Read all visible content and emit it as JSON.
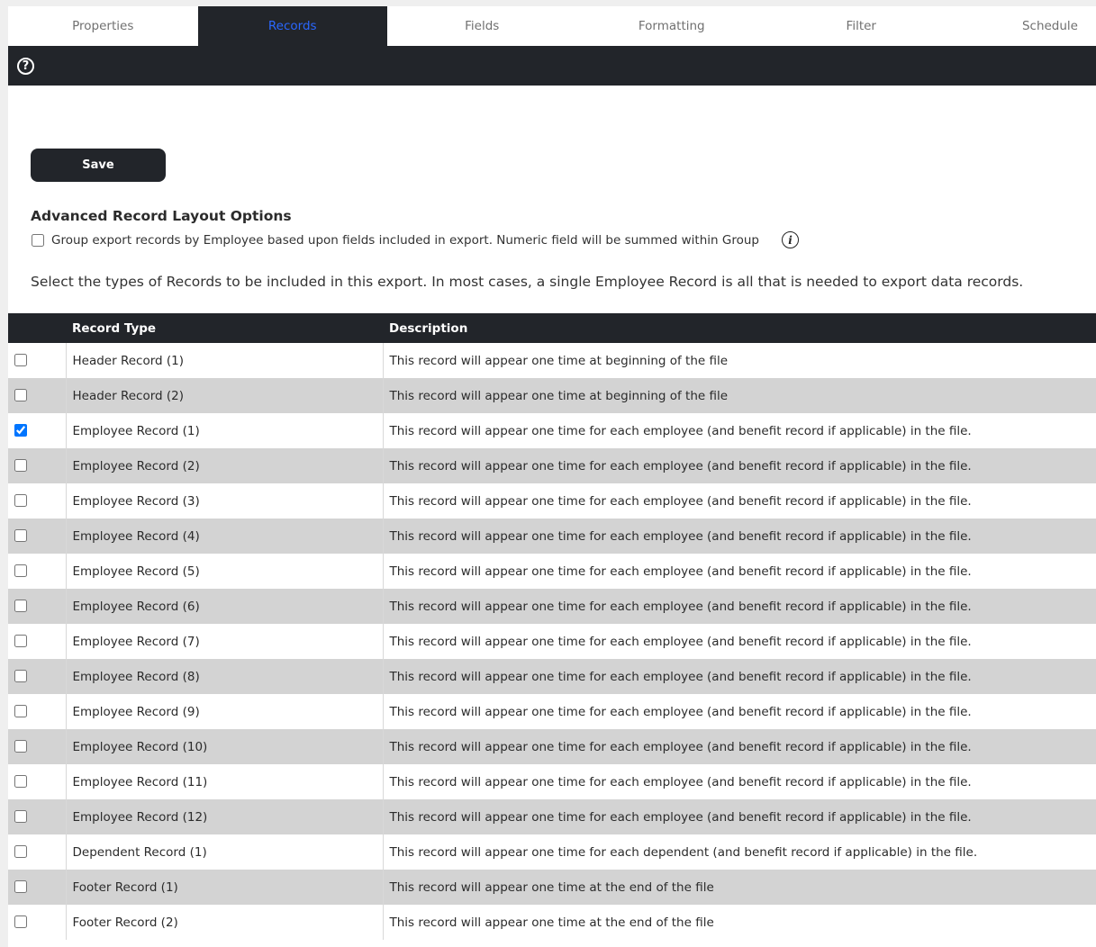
{
  "tabs": [
    "Properties",
    "Records",
    "Fields",
    "Formatting",
    "Filter",
    "Schedule"
  ],
  "active_tab": "Records",
  "save_label": "Save",
  "advanced": {
    "title": "Advanced Record Layout Options",
    "group_label": "Group export records by Employee based upon fields included in export. Numeric field will be summed within Group",
    "group_checked": false
  },
  "intro": "Select the types of Records to be included in this export. In most cases, a single Employee Record is all that is needed to export data records.",
  "table": {
    "headers": [
      "Record Type",
      "Description"
    ],
    "rows": [
      {
        "type": "Header Record (1)",
        "desc": "This record will appear one time at beginning of the file",
        "checked": false
      },
      {
        "type": "Header Record (2)",
        "desc": "This record will appear one time at beginning of the file",
        "checked": false
      },
      {
        "type": "Employee Record (1)",
        "desc": "This record will appear one time for each employee (and benefit record if applicable) in the file.",
        "checked": true
      },
      {
        "type": "Employee Record (2)",
        "desc": "This record will appear one time for each employee (and benefit record if applicable) in the file.",
        "checked": false
      },
      {
        "type": "Employee Record (3)",
        "desc": "This record will appear one time for each employee (and benefit record if applicable) in the file.",
        "checked": false
      },
      {
        "type": "Employee Record (4)",
        "desc": "This record will appear one time for each employee (and benefit record if applicable) in the file.",
        "checked": false
      },
      {
        "type": "Employee Record (5)",
        "desc": "This record will appear one time for each employee (and benefit record if applicable) in the file.",
        "checked": false
      },
      {
        "type": "Employee Record (6)",
        "desc": "This record will appear one time for each employee (and benefit record if applicable) in the file.",
        "checked": false
      },
      {
        "type": "Employee Record (7)",
        "desc": "This record will appear one time for each employee (and benefit record if applicable) in the file.",
        "checked": false
      },
      {
        "type": "Employee Record (8)",
        "desc": "This record will appear one time for each employee (and benefit record if applicable) in the file.",
        "checked": false
      },
      {
        "type": "Employee Record (9)",
        "desc": "This record will appear one time for each employee (and benefit record if applicable) in the file.",
        "checked": false
      },
      {
        "type": "Employee Record (10)",
        "desc": "This record will appear one time for each employee (and benefit record if applicable) in the file.",
        "checked": false
      },
      {
        "type": "Employee Record (11)",
        "desc": "This record will appear one time for each employee (and benefit record if applicable) in the file.",
        "checked": false
      },
      {
        "type": "Employee Record (12)",
        "desc": "This record will appear one time for each employee (and benefit record if applicable) in the file.",
        "checked": false
      },
      {
        "type": "Dependent Record (1)",
        "desc": "This record will appear one time for each dependent (and benefit record if applicable) in the file.",
        "checked": false
      },
      {
        "type": "Footer Record (1)",
        "desc": "This record will appear one time at the end of the file",
        "checked": false
      },
      {
        "type": "Footer Record (2)",
        "desc": "This record will appear one time at the end of the file",
        "checked": false
      }
    ]
  }
}
